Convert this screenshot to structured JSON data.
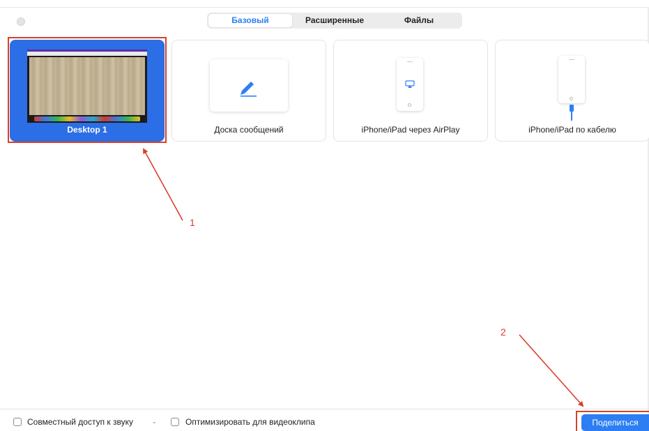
{
  "tabs": [
    {
      "label": "Базовый",
      "active": true
    },
    {
      "label": "Расширенные",
      "active": false
    },
    {
      "label": "Файлы",
      "active": false
    }
  ],
  "sources": [
    {
      "label": "Desktop 1",
      "selected": true
    },
    {
      "label": "Доска сообщений",
      "icon": "pen-icon"
    },
    {
      "label": "iPhone/iPad через AirPlay",
      "icon": "airplay-icon"
    },
    {
      "label": "iPhone/iPad по кабелю",
      "icon": "cable-icon"
    }
  ],
  "footer": {
    "share_audio_label": "Совместный доступ к звуку",
    "optimize_video_label": "Оптимизировать для видеоклипа",
    "share_button_label": "Поделиться"
  },
  "annotations": {
    "marker_1": "1",
    "marker_2": "2"
  },
  "colors": {
    "accent": "#2c7ef2",
    "selected": "#2b6ee6",
    "annotation": "#d9402b"
  }
}
